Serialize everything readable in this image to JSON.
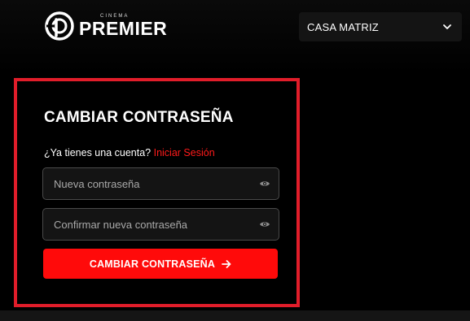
{
  "header": {
    "logo": {
      "small_text": "CINEMA",
      "brand_text": "PREMIER"
    },
    "location_select": {
      "selected": "CASA MATRIZ",
      "icon": "chevron-down-icon"
    }
  },
  "form": {
    "title": "CAMBIAR CONTRASEÑA",
    "account_prompt": "¿Ya tienes una cuenta?",
    "login_link": "Iniciar Sesión",
    "new_password": {
      "placeholder": "Nueva contraseña",
      "value": "",
      "icon": "eye-icon"
    },
    "confirm_password": {
      "placeholder": "Confirmar nueva contraseña",
      "value": "",
      "icon": "eye-icon"
    },
    "submit_label": "CAMBIAR CONTRASEÑA",
    "submit_icon": "arrow-right-icon"
  },
  "colors": {
    "accent": "#ff0a0a",
    "panel_border": "#e11d2a",
    "link": "#ff1a1a",
    "background": "#000000"
  }
}
